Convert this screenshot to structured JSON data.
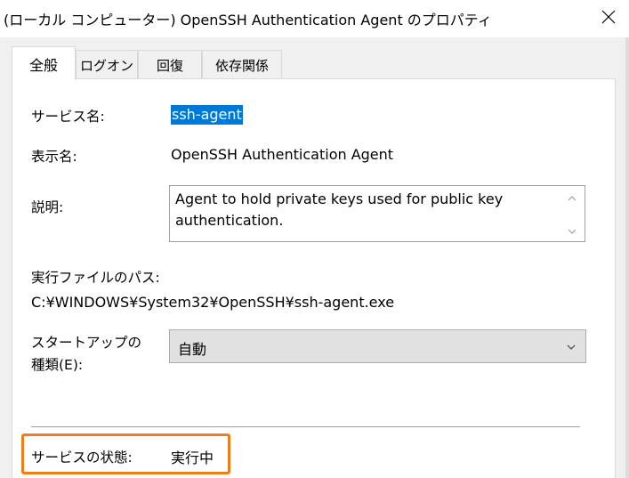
{
  "window": {
    "title": "(ローカル コンピューター) OpenSSH Authentication Agent のプロパティ"
  },
  "tabs": [
    {
      "label": "全般",
      "active": true
    },
    {
      "label": "ログオン",
      "active": false
    },
    {
      "label": "回復",
      "active": false
    },
    {
      "label": "依存関係",
      "active": false
    }
  ],
  "general": {
    "service_name_label": "サービス名:",
    "service_name_value": "ssh-agent",
    "display_name_label": "表示名:",
    "display_name_value": "OpenSSH Authentication Agent",
    "description_label": "説明:",
    "description_value": "Agent to hold private keys used for public key authentication.",
    "exe_path_label": "実行ファイルのパス:",
    "exe_path_value": "C:¥WINDOWS¥System32¥OpenSSH¥ssh-agent.exe",
    "startup_type_label_line1": "スタートアップの",
    "startup_type_label_line2": "種類(E):",
    "startup_type_value": "自動",
    "service_status_label": "サービスの状態:",
    "service_status_value": "実行中"
  },
  "icons": {
    "close": "close-icon",
    "scroll_up": "chevron-up-icon",
    "scroll_down": "chevron-down-icon",
    "dropdown": "chevron-down-icon"
  },
  "colors": {
    "selection_highlight": "#0078d7",
    "annotation_box": "#f07d17"
  }
}
